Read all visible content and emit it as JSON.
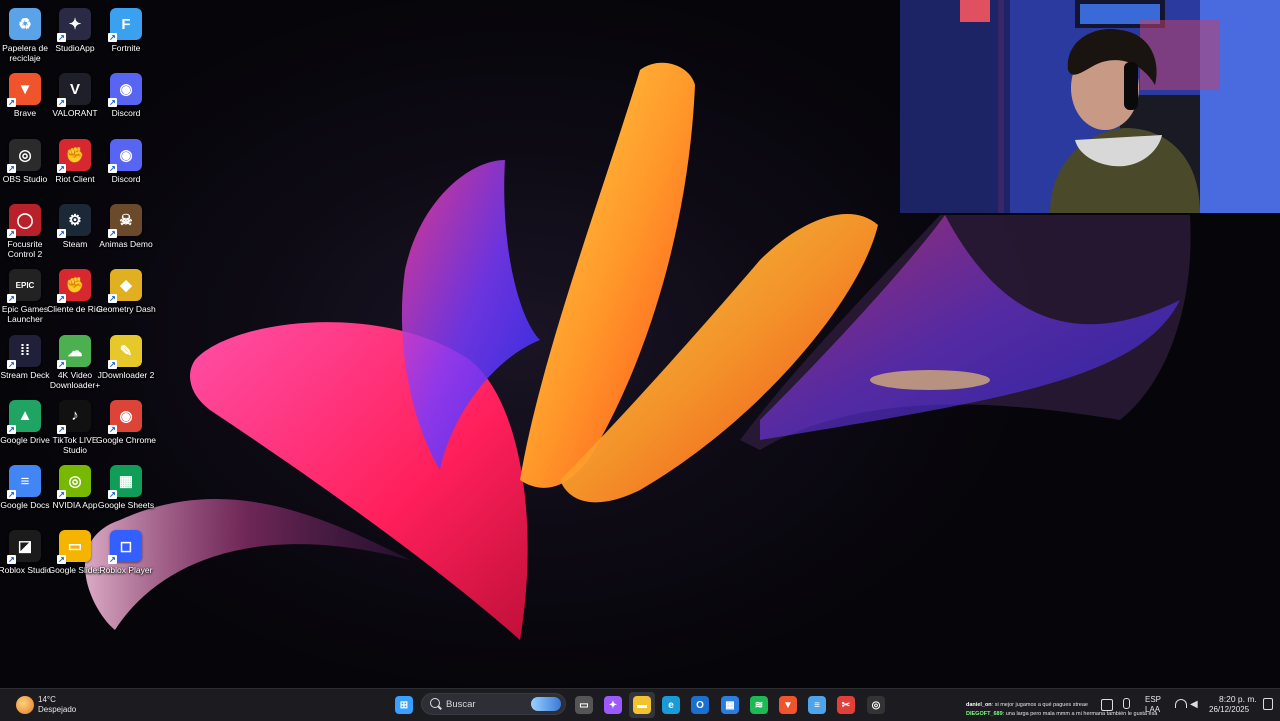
{
  "desktop_icons": [
    {
      "label": "Papelera de reciclaje",
      "icon": "recycle-bin-icon",
      "color": "#5aa3e8",
      "glyph": "♻"
    },
    {
      "label": "StudioApp",
      "icon": "studioapp-icon",
      "color": "#2a2a44",
      "glyph": "✦"
    },
    {
      "label": "Fortnite",
      "icon": "fortnite-icon",
      "color": "#3aa0f0",
      "glyph": "F"
    },
    {
      "label": "Brave",
      "icon": "brave-icon",
      "color": "#f0542c",
      "glyph": "▼"
    },
    {
      "label": "VALORANT",
      "icon": "valorant-icon",
      "color": "#1f1f2a",
      "glyph": "V"
    },
    {
      "label": "Discord",
      "icon": "discord-icon",
      "color": "#5865f2",
      "glyph": "◉"
    },
    {
      "label": "OBS Studio",
      "icon": "obs-icon",
      "color": "#2b2b2b",
      "glyph": "◎"
    },
    {
      "label": "Riot Client",
      "icon": "riot-client-icon",
      "color": "#d7282f",
      "glyph": "✊"
    },
    {
      "label": "Discord",
      "icon": "discord-icon",
      "color": "#5865f2",
      "glyph": "◉"
    },
    {
      "label": "Focusrite Control 2",
      "icon": "focusrite-icon",
      "color": "#b8202a",
      "glyph": "◯"
    },
    {
      "label": "Steam",
      "icon": "steam-icon",
      "color": "#1b2838",
      "glyph": "⚙"
    },
    {
      "label": "Animas Demo",
      "icon": "animas-icon",
      "color": "#6a4a2a",
      "glyph": "☠"
    },
    {
      "label": "Epic Games Launcher",
      "icon": "epic-games-icon",
      "color": "#222",
      "glyph": "EPIC"
    },
    {
      "label": "Cliente de Riot",
      "icon": "riot-client-icon",
      "color": "#d7282f",
      "glyph": "✊"
    },
    {
      "label": "Geometry Dash",
      "icon": "geometry-dash-icon",
      "color": "#e0b020",
      "glyph": "◆"
    },
    {
      "label": "Stream Deck",
      "icon": "stream-deck-icon",
      "color": "#20203a",
      "glyph": "⁞⁞"
    },
    {
      "label": "4K Video Downloader+",
      "icon": "4k-video-icon",
      "color": "#4caf50",
      "glyph": "☁"
    },
    {
      "label": "JDownloader 2",
      "icon": "jdownloader-icon",
      "color": "#e6c82a",
      "glyph": "✎"
    },
    {
      "label": "Google Drive",
      "icon": "google-drive-icon",
      "color": "#1fa463",
      "glyph": "▲"
    },
    {
      "label": "TikTok LIVE Studio",
      "icon": "tiktok-icon",
      "color": "#111",
      "glyph": "♪"
    },
    {
      "label": "Google Chrome",
      "icon": "chrome-icon",
      "color": "#db4437",
      "glyph": "◉"
    },
    {
      "label": "Google Docs",
      "icon": "google-docs-icon",
      "color": "#4285f4",
      "glyph": "≡"
    },
    {
      "label": "NVIDIA App",
      "icon": "nvidia-icon",
      "color": "#76b900",
      "glyph": "◎"
    },
    {
      "label": "Google Sheets",
      "icon": "google-sheets-icon",
      "color": "#0f9d58",
      "glyph": "▦"
    },
    {
      "label": "Roblox Studio",
      "icon": "roblox-studio-icon",
      "color": "#1b1b1b",
      "glyph": "◪"
    },
    {
      "label": "Google Slides",
      "icon": "google-slides-icon",
      "color": "#f4b400",
      "glyph": "▭"
    },
    {
      "label": "Roblox Player",
      "icon": "roblox-player-icon",
      "color": "#335fff",
      "glyph": "◻"
    }
  ],
  "weather": {
    "temp": "14°C",
    "condition": "Despejado",
    "icon": "weather-icon"
  },
  "search": {
    "placeholder": "Buscar"
  },
  "taskbar_apps": [
    {
      "name": "start-button",
      "color": "#3aa0ff",
      "glyph": "⊞"
    },
    {
      "name": "task-view",
      "color": "#555",
      "glyph": "▭"
    },
    {
      "name": "copilot",
      "color": "#9b59ff",
      "glyph": "✦"
    },
    {
      "name": "file-explorer",
      "color": "#f2c230",
      "glyph": "▬"
    },
    {
      "name": "edge",
      "color": "#1a9ad6",
      "glyph": "e"
    },
    {
      "name": "outlook",
      "color": "#1a6fd0",
      "glyph": "O"
    },
    {
      "name": "microsoft-store",
      "color": "#2a7ee0",
      "glyph": "▦"
    },
    {
      "name": "spotify",
      "color": "#1db954",
      "glyph": "≋"
    },
    {
      "name": "brave",
      "color": "#f0542c",
      "glyph": "▼"
    },
    {
      "name": "notepad",
      "color": "#4fa3e8",
      "glyph": "≡"
    },
    {
      "name": "snipping-tool",
      "color": "#e0403a",
      "glyph": "✂"
    },
    {
      "name": "obs",
      "color": "#333",
      "glyph": "◎"
    }
  ],
  "chat": [
    {
      "user": "daniel_on",
      "text": ": si mejor jugamos a qué pagues streae"
    },
    {
      "user": "DIEGOFT_689",
      "text": ": una larga pero mala mmm a mi hermana también le gusta esa"
    }
  ],
  "tray": {
    "lang": "ESP",
    "layout": "LAA",
    "time": "8:20 p. m.",
    "date": "26/12/2025"
  }
}
